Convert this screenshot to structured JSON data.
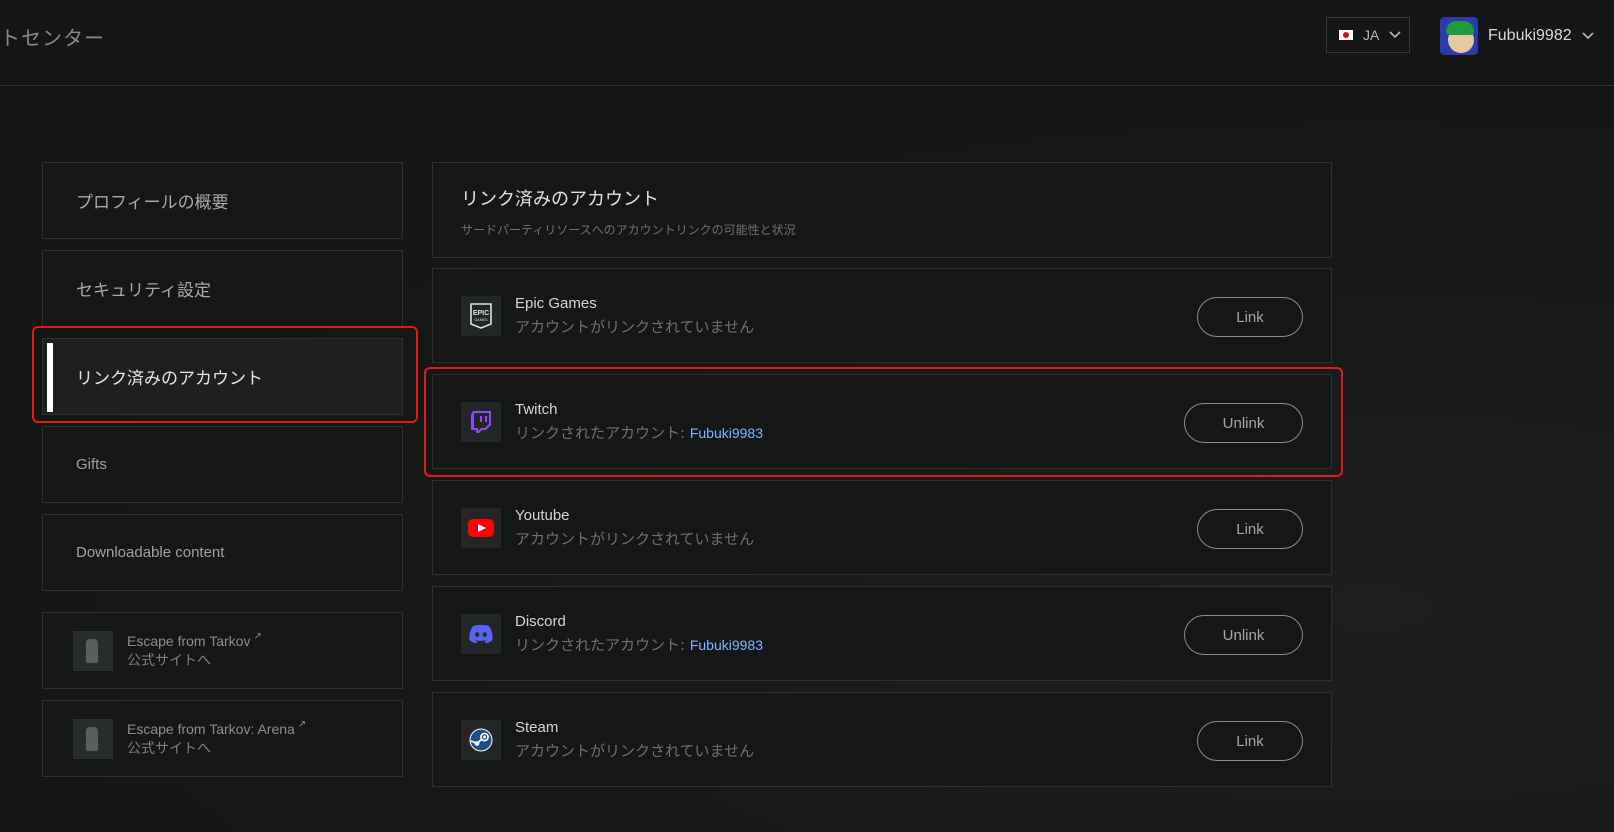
{
  "header": {
    "title": "トセンター",
    "language": {
      "code": "JA"
    },
    "user": {
      "name": "Fubuki9982"
    }
  },
  "sidebar": {
    "items": [
      {
        "label": "プロフィールの概要"
      },
      {
        "label": "セキュリティ設定"
      },
      {
        "label": "リンク済みのアカウント",
        "active": true
      },
      {
        "label": "Gifts"
      },
      {
        "label": "Downloadable content"
      }
    ],
    "external": [
      {
        "title": "Escape from Tarkov",
        "subtitle": "公式サイトへ"
      },
      {
        "title": "Escape from Tarkov: Arena",
        "subtitle": "公式サイトへ"
      }
    ]
  },
  "main": {
    "title": "リンク済みのアカウント",
    "subtitle": "サードパーティリソースへのアカウントリンクの可能性と状況",
    "accounts": [
      {
        "name": "Epic Games",
        "status": "アカウントがリンクされていません",
        "linked_user": "",
        "button": "Link",
        "icon": "epic-games-icon"
      },
      {
        "name": "Twitch",
        "status": "リンクされたアカウント:",
        "linked_user": "Fubuki9983",
        "button": "Unlink",
        "icon": "twitch-icon"
      },
      {
        "name": "Youtube",
        "status": "アカウントがリンクされていません",
        "linked_user": "",
        "button": "Link",
        "icon": "youtube-icon"
      },
      {
        "name": "Discord",
        "status": "リンクされたアカウント:",
        "linked_user": "Fubuki9983",
        "button": "Unlink",
        "icon": "discord-icon"
      },
      {
        "name": "Steam",
        "status": "アカウントがリンクされていません",
        "linked_user": "",
        "button": "Link",
        "icon": "steam-icon"
      }
    ]
  },
  "colors": {
    "background": "#161818",
    "highlight_red": "#e01b1b",
    "linked_user_blue": "#7fb6ff",
    "twitch_purple": "#9146ff",
    "youtube_red": "#ff0000",
    "discord_blurple": "#5865f2"
  }
}
